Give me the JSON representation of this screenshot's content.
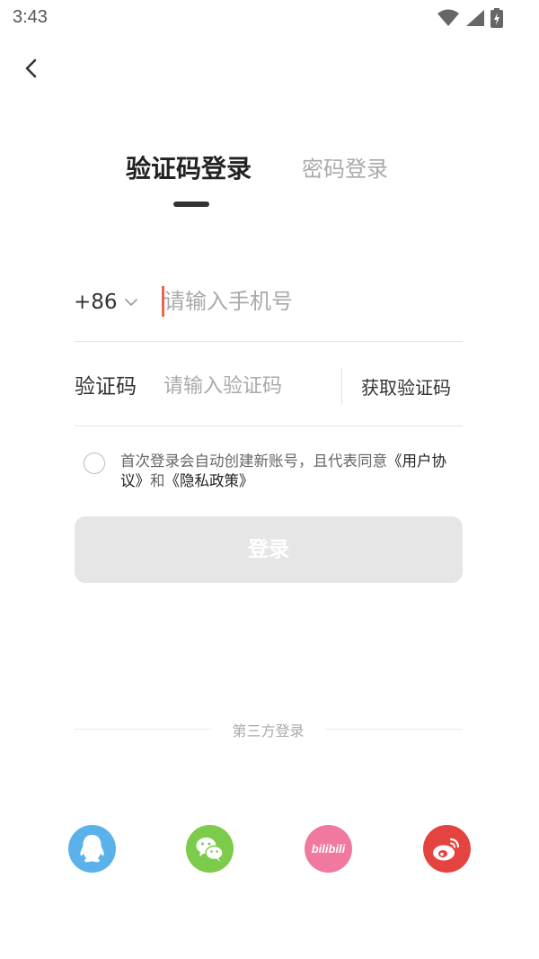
{
  "status_bar": {
    "time": "3:43"
  },
  "tabs": {
    "sms_login": "验证码登录",
    "password_login": "密码登录"
  },
  "phone": {
    "country_code": "+86",
    "placeholder": "请输入手机号",
    "value": ""
  },
  "verification": {
    "label": "验证码",
    "placeholder": "请输入验证码",
    "value": "",
    "get_code": "获取验证码"
  },
  "agreement": {
    "checked": false,
    "prefix": "首次登录会自动创建新账号，且代表同意",
    "user_agreement": "《用户协议》",
    "conjunction": "和",
    "privacy_policy": "《隐私政策》"
  },
  "login_button": "登录",
  "third_party": {
    "label": "第三方登录",
    "providers": [
      {
        "name": "qq-icon",
        "color": "#5bb2ea"
      },
      {
        "name": "wechat-icon",
        "color": "#7ccb4a"
      },
      {
        "name": "bilibili-icon",
        "color": "#f1799f",
        "text": "bilibili"
      },
      {
        "name": "weibo-icon",
        "color": "#e5433f"
      }
    ]
  },
  "colors": {
    "cursor": "#e8664f",
    "button_disabled": "#e6e6e6"
  }
}
